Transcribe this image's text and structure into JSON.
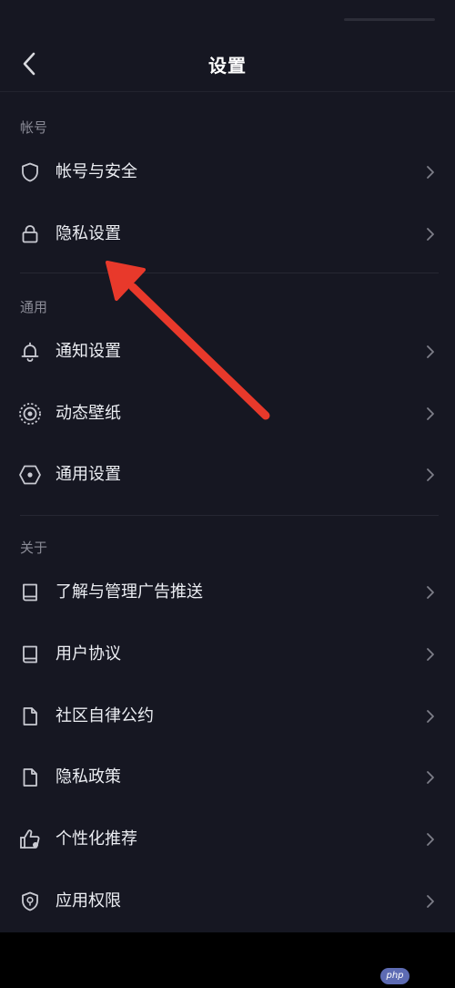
{
  "header": {
    "title": "设置"
  },
  "sections": {
    "account": {
      "label": "帐号",
      "items": [
        {
          "label": "帐号与安全",
          "icon": "shield-icon"
        },
        {
          "label": "隐私设置",
          "icon": "lock-icon"
        }
      ]
    },
    "general": {
      "label": "通用",
      "items": [
        {
          "label": "通知设置",
          "icon": "bell-icon"
        },
        {
          "label": "动态壁纸",
          "icon": "live-wallpaper-icon"
        },
        {
          "label": "通用设置",
          "icon": "hexagon-settings-icon"
        }
      ]
    },
    "about": {
      "label": "关于",
      "items": [
        {
          "label": "了解与管理广告推送",
          "icon": "book-icon"
        },
        {
          "label": "用户协议",
          "icon": "book-icon"
        },
        {
          "label": "社区自律公约",
          "icon": "document-icon"
        },
        {
          "label": "隐私政策",
          "icon": "document-icon"
        },
        {
          "label": "个性化推荐",
          "icon": "thumbs-up-icon"
        },
        {
          "label": "应用权限",
          "icon": "shield-location-icon"
        }
      ]
    }
  },
  "watermark": {
    "text": "php"
  },
  "colors": {
    "background": "#161722",
    "text": "#eceef3",
    "muted": "#8a8b96",
    "annotation_arrow": "#e8392b"
  }
}
